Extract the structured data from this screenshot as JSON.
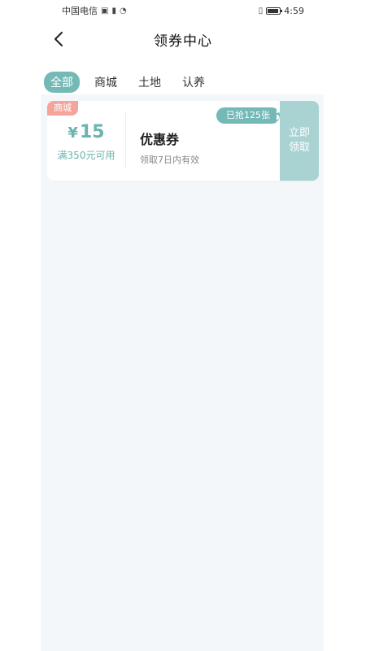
{
  "status_bar": {
    "carrier": "中国电信",
    "time": "4:59"
  },
  "nav": {
    "title": "领券中心"
  },
  "tabs": [
    {
      "label": "全部",
      "active": true
    },
    {
      "label": "商城",
      "active": false
    },
    {
      "label": "土地",
      "active": false
    },
    {
      "label": "认养",
      "active": false
    }
  ],
  "coupons": [
    {
      "tag": "商城",
      "currency": "¥",
      "amount": "15",
      "condition": "满350元可用",
      "claimed": "已抢125张",
      "name": "优惠券",
      "validity": "领取7日内有效",
      "claim_line1": "立即",
      "claim_line2": "领取"
    }
  ],
  "colors": {
    "accent": "#74b9b6",
    "tag": "#f4a49b",
    "claim_button": "#a9d3d2",
    "panel_bg": "#f4f7fa"
  }
}
